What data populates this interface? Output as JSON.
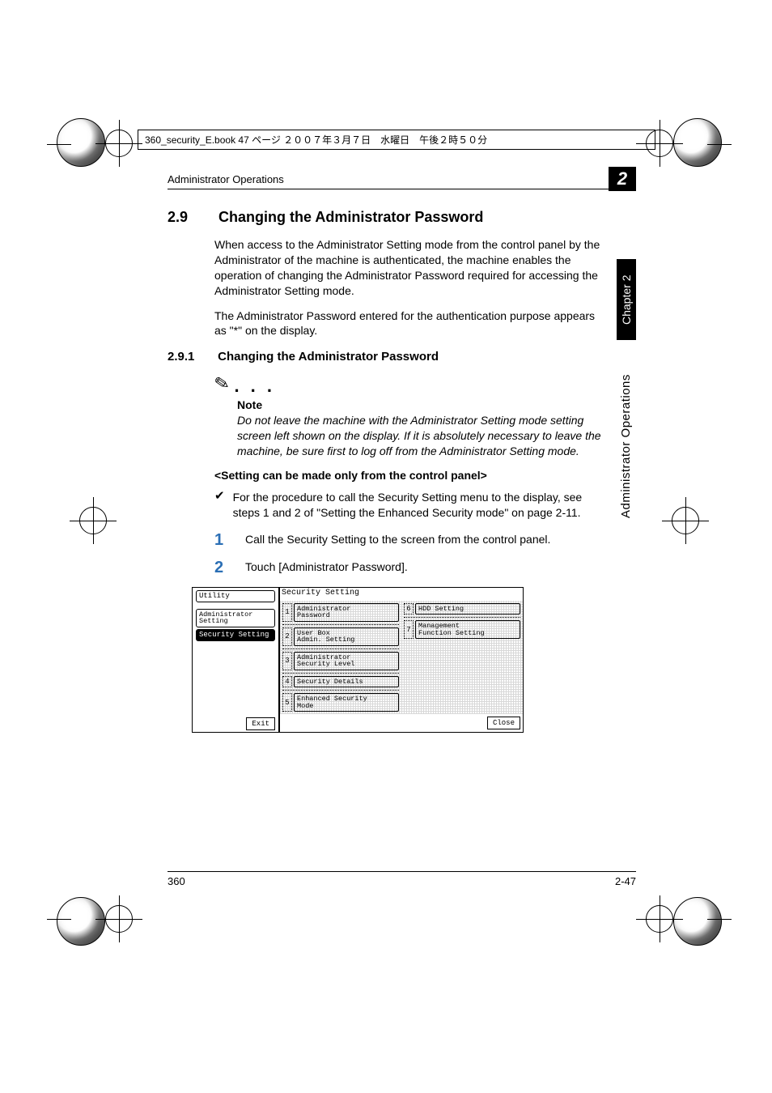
{
  "meta": {
    "topbox": "360_security_E.book  47 ページ  ２００７年３月７日　水曜日　午後２時５０分"
  },
  "header": {
    "running": "Administrator Operations",
    "chapter_number": "2",
    "side_chapter": "Chapter 2",
    "side_section": "Administrator Operations"
  },
  "section": {
    "number": "2.9",
    "title": "Changing the Administrator Password",
    "para1": "When access to the Administrator Setting mode from the control panel by the Administrator of the machine is authenticated, the machine enables the operation of changing the Administrator Password required for accessing the Administrator Setting mode.",
    "para2": "The Administrator Password entered for the authentication purpose appears as \"*\" on the display."
  },
  "subsection": {
    "number": "2.9.1",
    "title": "Changing the Administrator Password"
  },
  "note": {
    "heading": "Note",
    "text": "Do not leave the machine with the Administrator Setting mode setting screen left shown on the display. If it is absolutely necessary to leave the machine, be sure first to log off from the Administrator Setting mode."
  },
  "subheading": "<Setting can be made only from the control panel>",
  "bullet1": "For the procedure to call the Security Setting menu to the display, see steps 1 and 2 of \"Setting the Enhanced Security mode\" on page 2-11.",
  "steps": {
    "s1_num": "1",
    "s1_text": "Call the Security Setting to the screen from the control panel.",
    "s2_num": "2",
    "s2_text": "Touch [Administrator Password]."
  },
  "screenshot": {
    "left": {
      "utility": "Utility",
      "admin_setting": "Administrator\nSetting",
      "security_setting": "Security Setting",
      "exit": "Exit"
    },
    "right": {
      "title": "Security Setting",
      "items_col1": [
        {
          "n": "1",
          "label": "Administrator\nPassword"
        },
        {
          "n": "2",
          "label": "User Box\nAdmin. Setting"
        },
        {
          "n": "3",
          "label": "Administrator\nSecurity Level"
        },
        {
          "n": "4",
          "label": "Security Details"
        },
        {
          "n": "5",
          "label": "Enhanced Security\nMode"
        }
      ],
      "items_col2": [
        {
          "n": "6",
          "label": "HDD Setting"
        },
        {
          "n": "7",
          "label": "Management\nFunction Setting"
        }
      ],
      "close": "Close"
    }
  },
  "footer": {
    "left": "360",
    "right": "2-47"
  }
}
